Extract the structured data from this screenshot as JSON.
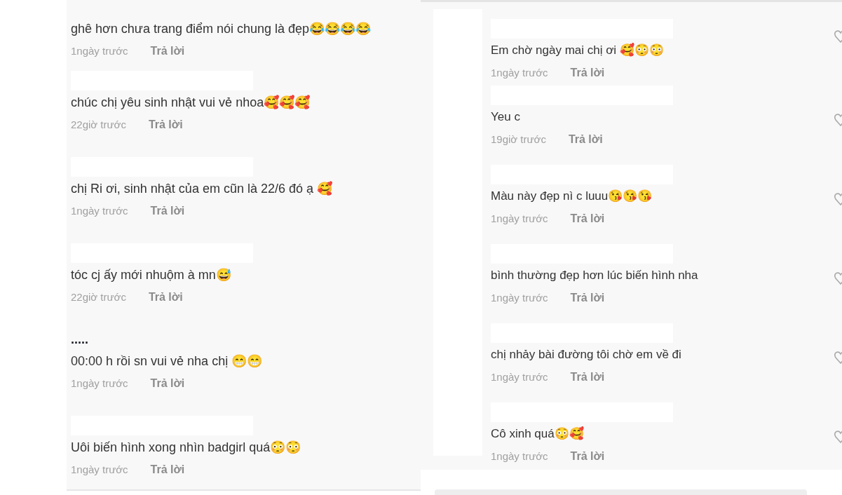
{
  "left_panel": {
    "comments": [
      {
        "username_redacted": false,
        "text": "ghê hơn chưa trang điểm nói chung là đẹp😂😂😂😂",
        "time": "1ngày trước",
        "reply": "Trả lời"
      },
      {
        "username_redacted": true,
        "text": "chúc chị yêu sinh nhật vui vẻ nhoa🥰🥰🥰",
        "time": "22giờ trước",
        "reply": "Trả lời"
      },
      {
        "username_redacted": true,
        "text": "chị Ri ơi, sinh nhật của em cũn là 22/6 đó ạ 🥰",
        "time": "1ngày trước",
        "reply": "Trả lời"
      },
      {
        "username_redacted": true,
        "text": "tóc cj ấy mới nhuộm à mn😅",
        "time": "22giờ trước",
        "reply": "Trả lời"
      },
      {
        "username_redacted": false,
        "username": ".....",
        "text": "00:00 h rồi sn vui vẻ nha chị 😁😁",
        "time": "1ngày trước",
        "reply": "Trả lời"
      },
      {
        "username_redacted": true,
        "text": "Uôi biến hình xong nhìn badgirl quá😳😳",
        "time": "1ngày trước",
        "reply": "Trả lời"
      }
    ]
  },
  "right_panel": {
    "comments": [
      {
        "username_redacted": true,
        "text": "Em chờ ngày mai chị ơi 🥰😳😳",
        "time": "1ngày trước",
        "reply": "Trả lời"
      },
      {
        "username_redacted": true,
        "text": "Yeu c",
        "time": "19giờ trước",
        "reply": "Trả lời"
      },
      {
        "username_redacted": true,
        "text": "Màu này đẹp nì c luuu😘😘😘",
        "time": "1ngày trước",
        "reply": "Trả lời"
      },
      {
        "username_redacted": true,
        "text": "bình thường đẹp hơn lúc biến hình nha",
        "time": "1ngày trước",
        "reply": "Trả lời"
      },
      {
        "username_redacted": true,
        "text": "chị nhảy bài đường tôi chờ em về đi",
        "time": "1ngày trước",
        "reply": "Trả lời"
      },
      {
        "username_redacted": true,
        "text": "Cô xinh quá😳🥰",
        "time": "1ngày trước",
        "reply": "Trả lời"
      }
    ]
  }
}
